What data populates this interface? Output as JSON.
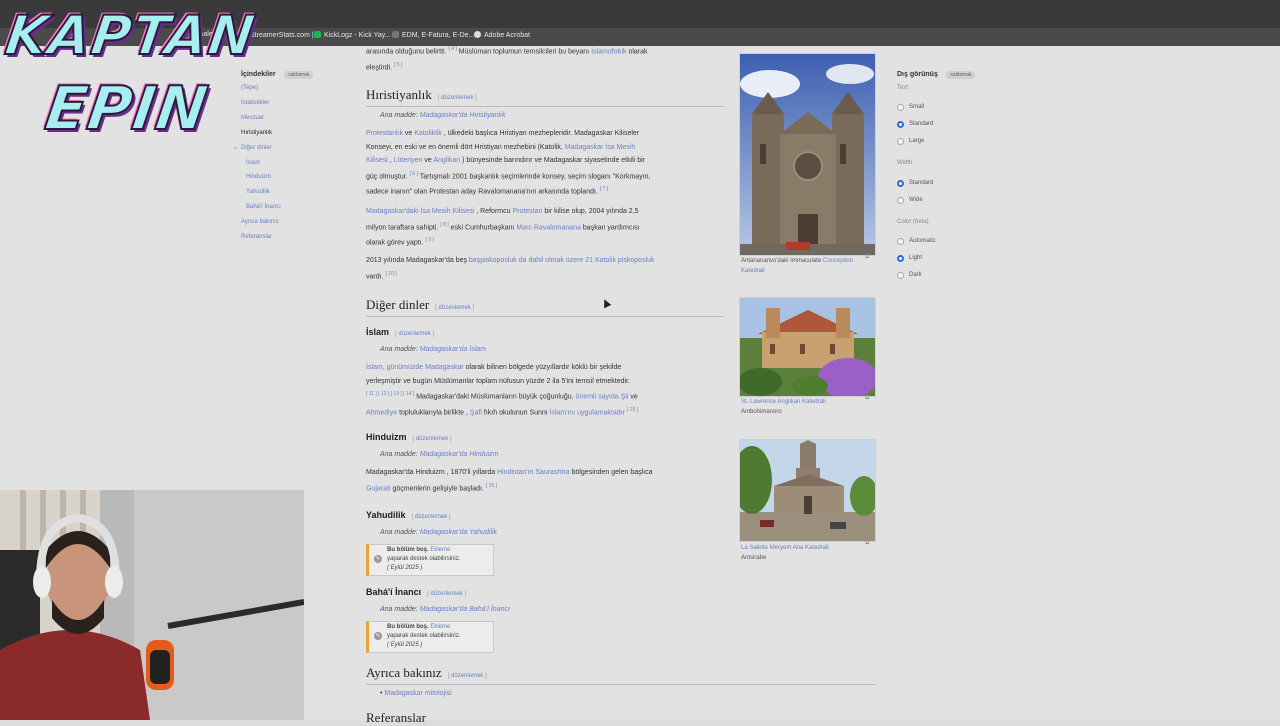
{
  "browser": {
    "bookmarks": [
      {
        "label": "ynalets",
        "color": "#555"
      },
      {
        "label": "StreamerStats.com |...",
        "color": "#f2a900"
      },
      {
        "label": "KickLogz - Kick Yay...",
        "color": "#1eb853"
      },
      {
        "label": "EDM, E-Fatura, E-De...",
        "color": "#888"
      },
      {
        "label": "Adobe Acrobat",
        "color": "#e0e0e0"
      }
    ]
  },
  "toc": {
    "title": "İçindekiler",
    "hide_label": "saklamak",
    "items": [
      {
        "label": "(Tepe)",
        "level": 0,
        "current": false
      },
      {
        "label": "İstatistikler",
        "level": 0,
        "current": false
      },
      {
        "label": "Mevzuat",
        "level": 0,
        "current": false
      },
      {
        "label": "Hıristiyanlık",
        "level": 0,
        "current": true
      },
      {
        "label": "Diğer dinler",
        "level": 0,
        "current": false
      },
      {
        "label": "İslam",
        "level": 1,
        "current": false
      },
      {
        "label": "Hinduizm",
        "level": 1,
        "current": false
      },
      {
        "label": "Yahudilik",
        "level": 1,
        "current": false
      },
      {
        "label": "Bahá'í İnancı",
        "level": 1,
        "current": false
      },
      {
        "label": "Ayrıca bakınız",
        "level": 0,
        "current": false
      },
      {
        "label": "Referanslar",
        "level": 0,
        "current": false
      }
    ]
  },
  "article": {
    "edit_label": "düzenlemek",
    "top_fragment": {
      "line1_a": "arasında olduğunu belirtti.",
      "line1_sup": "[ 4 ]",
      "line1_b": " Müslüman toplumun temsilcileri bu beyanı ",
      "line1_link": "İslamofobik",
      "line1_c": " olarak",
      "line2": "eleştirdi.",
      "line2_sup": "[ 5 ]"
    },
    "christianity": {
      "heading": "Hıristiyanlık",
      "main_prefix": "Ana madde:",
      "main_link": "Madagaskar'da Hıristiyanlık",
      "p1": {
        "l1_link1": "Protestanlık",
        "l1_a": " ve ",
        "l1_link2": "Katoliklik",
        "l1_b": " , ülkedeki başlıca Hristiyan mezhepleridir. Madagaskar Kiliseler",
        "l2_a": "Konseyi, en eski ve en önemli dört Hristiyan mezhebini (Katolik, ",
        "l2_link": "Madagaskar İsa Mesih",
        "l3_link1": "Kilisesi",
        "l3_a": " , ",
        "l3_link2": "Lüteriyen",
        "l3_b": " ve ",
        "l3_link3": "Anglikan",
        "l3_c": " ) bünyesinde barındırır ve Madagaskar siyasetinde etkili bir",
        "l4_a": "güç olmuştur.",
        "l4_sup": "[ 6 ]",
        "l4_b": " Tartışmalı 2001 başkanlık seçimlerinde konsey, seçim sloganı \"Korkmayın,",
        "l5_a": "sadece inanın\" olan Protestan aday Ravalomanana'nın arkasında toplandı.",
        "l5_sup": "[ 7 ]"
      },
      "p2": {
        "l1_link1": "Madagaskar'daki İsa Mesih Kilisesi",
        "l1_a": " , Reformcu ",
        "l1_link2": "Protestan",
        "l1_b": " bir kilise olup, 2004 yılında 2,5",
        "l2_a": "milyon taraftara sahipti.",
        "l2_sup": "[ 8 ]",
        "l2_b": " eski Cumhurbaşkanı ",
        "l2_link": "Marc Ravalomanana",
        "l2_c": " başkan yardımcısı",
        "l3_a": "olarak görev yaptı.",
        "l3_sup": "[ 9 ]"
      },
      "p3": {
        "l1_a": "2013 yılında Madagaskar'da beş ",
        "l1_link": "başpiskoposluk da dahil olmak üzere 21 Katolik piskoposluk",
        "l2_a": "vardı.",
        "l2_sup": "[ 10 ]"
      }
    },
    "other": {
      "heading": "Diğer dinler",
      "islam": {
        "heading": "İslam",
        "main_prefix": "Ana madde:",
        "main_link": "Madagaskar'da İslam",
        "l1_link": "İslam, günümüzde Madagaskar",
        "l1_a": " olarak bilinen bölgede yüzyıllardır köklü bir şekilde",
        "l2_a": "yerleşmiştir ve bugün Müslümanlar toplam nüfusun yüzde 2 ila 5'ini temsil etmektedir.",
        "l3_sup": "[ 11 ] [ 12 ] [ 13 ] [ 14 ]",
        "l3_a": " Madagaskar'daki Müslümanların büyük çoğunluğu, ",
        "l3_link": "önemli sayıda Şii",
        "l3_b": " ve",
        "l4_link1": "Ahmediye",
        "l4_a": " topluluklarıyla birlikte , ",
        "l4_link2": "Şafi",
        "l4_b": " fıkıh okulunun Sunni ",
        "l4_link3": "İslam'ını uygulamaktadır",
        "l4_sup": "[ 15 ]"
      },
      "hinduism": {
        "heading": "Hinduizm",
        "main_prefix": "Ana madde:",
        "main_link": "Madagaskar'da Hinduizm",
        "l1_a": "Madagaskar'da Hinduizm , 1870'li yıllarda ",
        "l1_link": "Hindistan'ın Saurashtra",
        "l1_b": " bölgesinden gelen başlıca",
        "l2_link": "Gujarati",
        "l2_a": " göçmenlerin gelişiyle başladı.",
        "l2_sup": "[ 16 ]"
      },
      "judaism": {
        "heading": "Yahudilik",
        "main_prefix": "Ana madde:",
        "main_link": "Madagaskar'da Yahudilik",
        "stub_bold": "Bu bölüm boş.",
        "stub_link": "Ekleme",
        "stub_text": "yaparak destek olabilirsiniz.",
        "stub_date": "( Eylül 2025 )"
      },
      "bahai": {
        "heading": "Bahá'í İnancı",
        "main_prefix": "Ana madde:",
        "main_link": "Madagaskar'da Bahá'í İnancı",
        "stub_bold": "Bu bölüm boş.",
        "stub_link": "Ekleme",
        "stub_text": "yaparak destek olabilirsiniz.",
        "stub_date": "( Eylül 2025 )"
      }
    },
    "see_also": {
      "heading": "Ayrıca bakınız",
      "items": [
        "Madagaskar mitolojisi"
      ]
    },
    "references": {
      "heading": "Referanslar"
    }
  },
  "images": [
    {
      "caption_a": "Antananarivo'daki Immaculate",
      "caption_link": "Conception Katedrali"
    },
    {
      "caption_link": "St. Lawrence Anglikan Katedrali",
      "caption_b": "Ambohimanoro"
    },
    {
      "caption_link": "La Salette Meryem Ana Katedrali",
      "caption_b": "Antsirabe"
    }
  ],
  "appearance": {
    "title": "Dış görünüş",
    "hide_label": "saklamak",
    "groups": [
      {
        "name": "Text",
        "options": [
          {
            "label": "Small",
            "on": false
          },
          {
            "label": "Standard",
            "on": true
          },
          {
            "label": "Large",
            "on": false
          }
        ]
      },
      {
        "name": "Width",
        "options": [
          {
            "label": "Standard",
            "on": true
          },
          {
            "label": "Wide",
            "on": false
          }
        ]
      },
      {
        "name": "Color (beta)",
        "options": [
          {
            "label": "Automatic",
            "on": false
          },
          {
            "label": "Light",
            "on": true
          },
          {
            "label": "Dark",
            "on": false
          }
        ]
      }
    ]
  },
  "overlay": {
    "logo_line1": "KAPTAN",
    "logo_line2": "EPIN"
  }
}
